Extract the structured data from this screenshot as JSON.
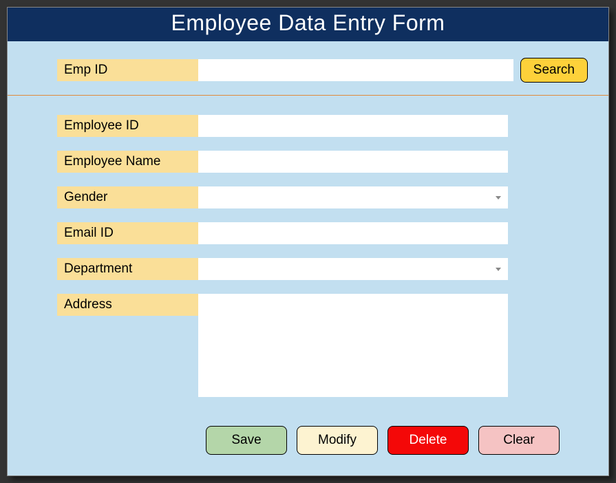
{
  "title": "Employee Data Entry Form",
  "search": {
    "label": "Emp ID",
    "value": "",
    "button": "Search"
  },
  "fields": {
    "employee_id": {
      "label": "Employee ID",
      "value": ""
    },
    "employee_name": {
      "label": "Employee Name",
      "value": ""
    },
    "gender": {
      "label": "Gender",
      "value": ""
    },
    "email_id": {
      "label": "Email ID",
      "value": ""
    },
    "department": {
      "label": "Department",
      "value": ""
    },
    "address": {
      "label": "Address",
      "value": ""
    }
  },
  "buttons": {
    "save": "Save",
    "modify": "Modify",
    "delete": "Delete",
    "clear": "Clear"
  }
}
